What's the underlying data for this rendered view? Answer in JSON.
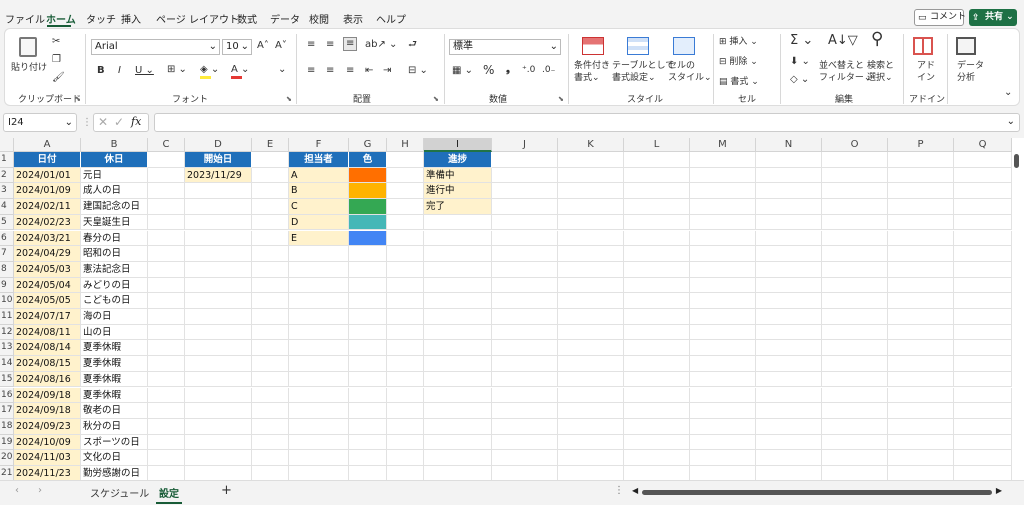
{
  "menu": [
    "ファイル",
    "ホーム",
    "タッチ",
    "挿入",
    "ページ レイアウト",
    "数式",
    "データ",
    "校閲",
    "表示",
    "ヘルプ"
  ],
  "comment_label": "コメント",
  "share_label": "共有",
  "ribbon": {
    "paste": "貼り付け",
    "clipboard": "クリップボード",
    "font_name": "Arial",
    "font_size": "10",
    "font_group": "フォント",
    "alignment": "配置",
    "number_format": "標準",
    "number": "数値",
    "cond_format": [
      "条件付き",
      "書式"
    ],
    "table_format": [
      "テーブルとして",
      "書式設定"
    ],
    "cell_style": [
      "セルの",
      "スタイル"
    ],
    "style": "スタイル",
    "insert": "挿入",
    "delete": "削除",
    "format": "書式",
    "cells": "セル",
    "sort_filter": [
      "並べ替えと",
      "フィルター"
    ],
    "find_select": [
      "検索と",
      "選択"
    ],
    "edit": "編集",
    "addin": [
      "アド",
      "イン"
    ],
    "addin_group": "アドイン",
    "data_analysis": [
      "データ",
      "分析"
    ]
  },
  "name_box": "I24",
  "fx": "fx",
  "columns": [
    "A",
    "B",
    "C",
    "D",
    "E",
    "F",
    "G",
    "H",
    "I",
    "J",
    "K",
    "L",
    "M",
    "N",
    "O",
    "P",
    "Q"
  ],
  "rows": [
    "1",
    "2",
    "3",
    "4",
    "5",
    "6",
    "7",
    "8",
    "9",
    "10",
    "11",
    "12",
    "13",
    "14",
    "15",
    "16",
    "17",
    "18",
    "19",
    "20",
    "21"
  ],
  "holidays": {
    "header_date": "日付",
    "header_name": "休日",
    "items": [
      [
        "2024/01/01",
        "元日"
      ],
      [
        "2024/01/09",
        "成人の日"
      ],
      [
        "2024/02/11",
        "建国記念の日"
      ],
      [
        "2024/02/23",
        "天皇誕生日"
      ],
      [
        "2024/03/21",
        "春分の日"
      ],
      [
        "2024/04/29",
        "昭和の日"
      ],
      [
        "2024/05/03",
        "憲法記念日"
      ],
      [
        "2024/05/04",
        "みどりの日"
      ],
      [
        "2024/05/05",
        "こどもの日"
      ],
      [
        "2024/07/17",
        "海の日"
      ],
      [
        "2024/08/11",
        "山の日"
      ],
      [
        "2024/08/14",
        "夏季休暇"
      ],
      [
        "2024/08/15",
        "夏季休暇"
      ],
      [
        "2024/08/16",
        "夏季休暇"
      ],
      [
        "2024/09/18",
        "夏季休暇"
      ],
      [
        "2024/09/18",
        "敬老の日"
      ],
      [
        "2024/09/23",
        "秋分の日"
      ],
      [
        "2024/10/09",
        "スポーツの日"
      ],
      [
        "2024/11/03",
        "文化の日"
      ],
      [
        "2024/11/23",
        "勤労感謝の日"
      ]
    ]
  },
  "start": {
    "header": "開始日",
    "value": "2023/11/29"
  },
  "assignees": {
    "header_person": "担当者",
    "header_color": "色",
    "items": [
      {
        "name": "A",
        "color": "#ff6f00"
      },
      {
        "name": "B",
        "color": "#ffb300"
      },
      {
        "name": "C",
        "color": "#34a853"
      },
      {
        "name": "D",
        "color": "#45b7b7"
      },
      {
        "name": "E",
        "color": "#4285f4"
      }
    ]
  },
  "progress": {
    "header": "進捗",
    "items": [
      "準備中",
      "進行中",
      "完了"
    ]
  },
  "sheets": [
    "スケジュール",
    "設定"
  ],
  "active_sheet": "設定",
  "colors": {
    "header_blue": "#1f6fba",
    "yellow": "#fff2cc",
    "excel_green": "#185c37"
  }
}
